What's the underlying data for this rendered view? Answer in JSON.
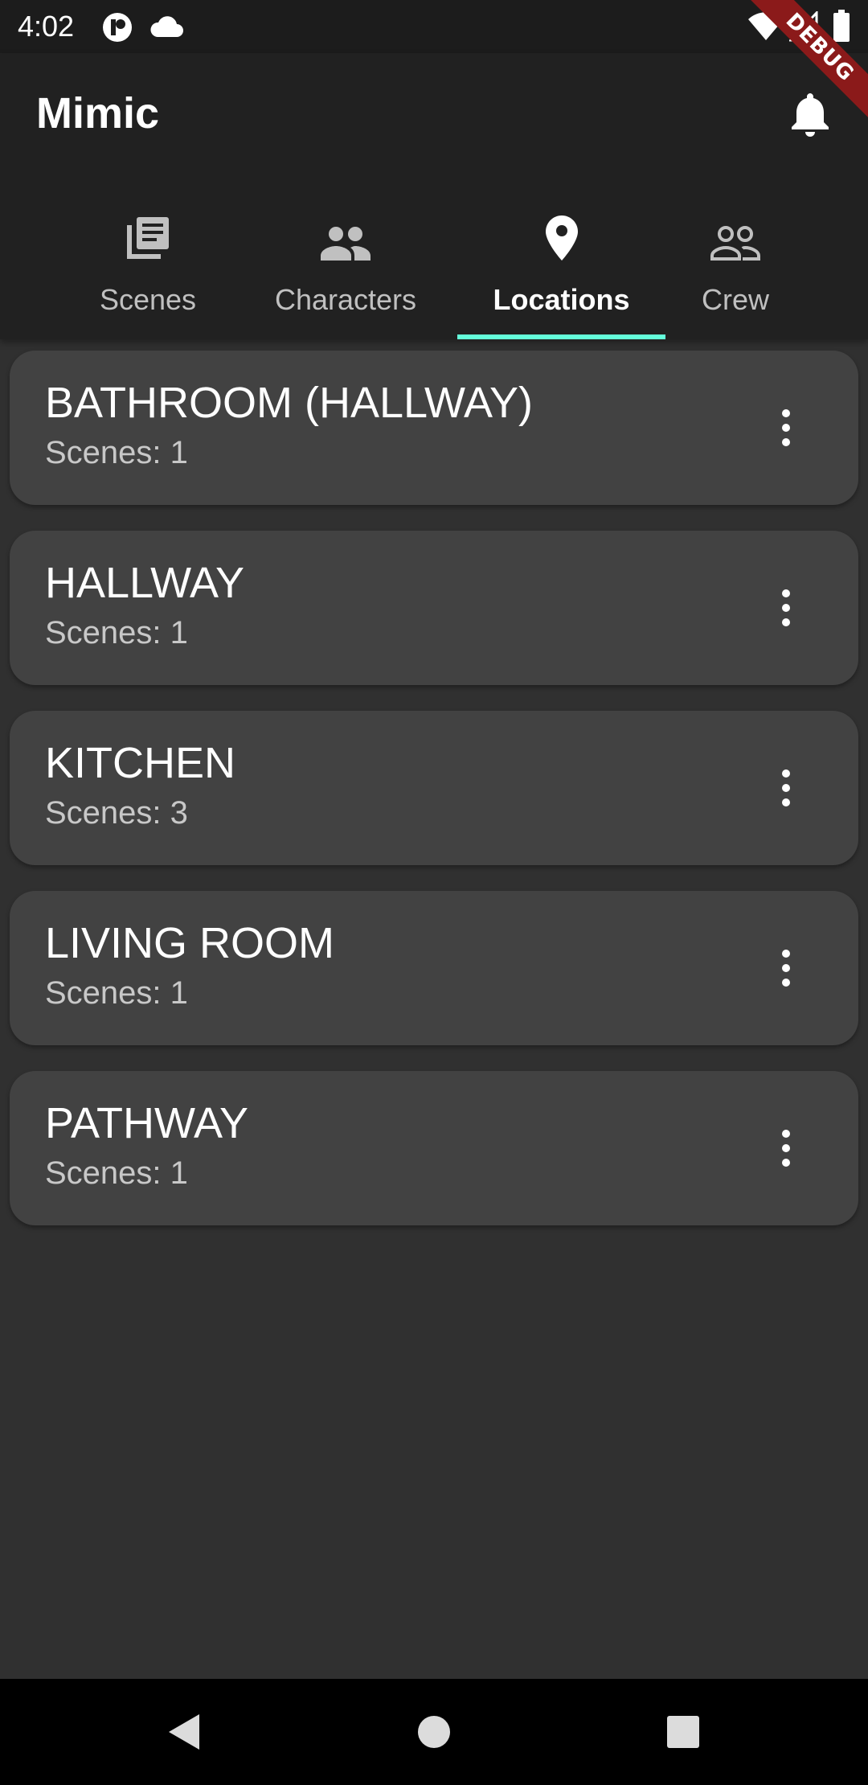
{
  "status_bar": {
    "time": "4:02",
    "left_icons": [
      "app-notification-icon",
      "cloud-icon"
    ],
    "right_icons": [
      "wifi-icon",
      "cell-signal-icon",
      "battery-icon"
    ]
  },
  "debug_banner": {
    "label": "DEBUG",
    "color": "#8b1a1a"
  },
  "app_bar": {
    "title": "Mimic",
    "action_icon": "bell-icon"
  },
  "tabs": [
    {
      "label": "Scenes",
      "icon": "library-books-icon",
      "active": false
    },
    {
      "label": "Characters",
      "icon": "people-icon",
      "active": false
    },
    {
      "label": "Locations",
      "icon": "location-pin-icon",
      "active": true
    },
    {
      "label": "Crew",
      "icon": "people-outline-icon",
      "active": false
    }
  ],
  "locations": [
    {
      "name": "BATHROOM (HALLWAY)",
      "scenes": "Scenes: 1"
    },
    {
      "name": "HALLWAY",
      "scenes": "Scenes: 1"
    },
    {
      "name": "KITCHEN",
      "scenes": "Scenes: 3"
    },
    {
      "name": "LIVING ROOM",
      "scenes": "Scenes: 1"
    },
    {
      "name": "PATHWAY",
      "scenes": "Scenes: 1"
    }
  ],
  "colors": {
    "background": "#303030",
    "app_bar": "#212121",
    "card": "#424242",
    "accent": "#64ffda"
  },
  "nav_bar": [
    "back-icon",
    "home-icon",
    "recents-icon"
  ]
}
